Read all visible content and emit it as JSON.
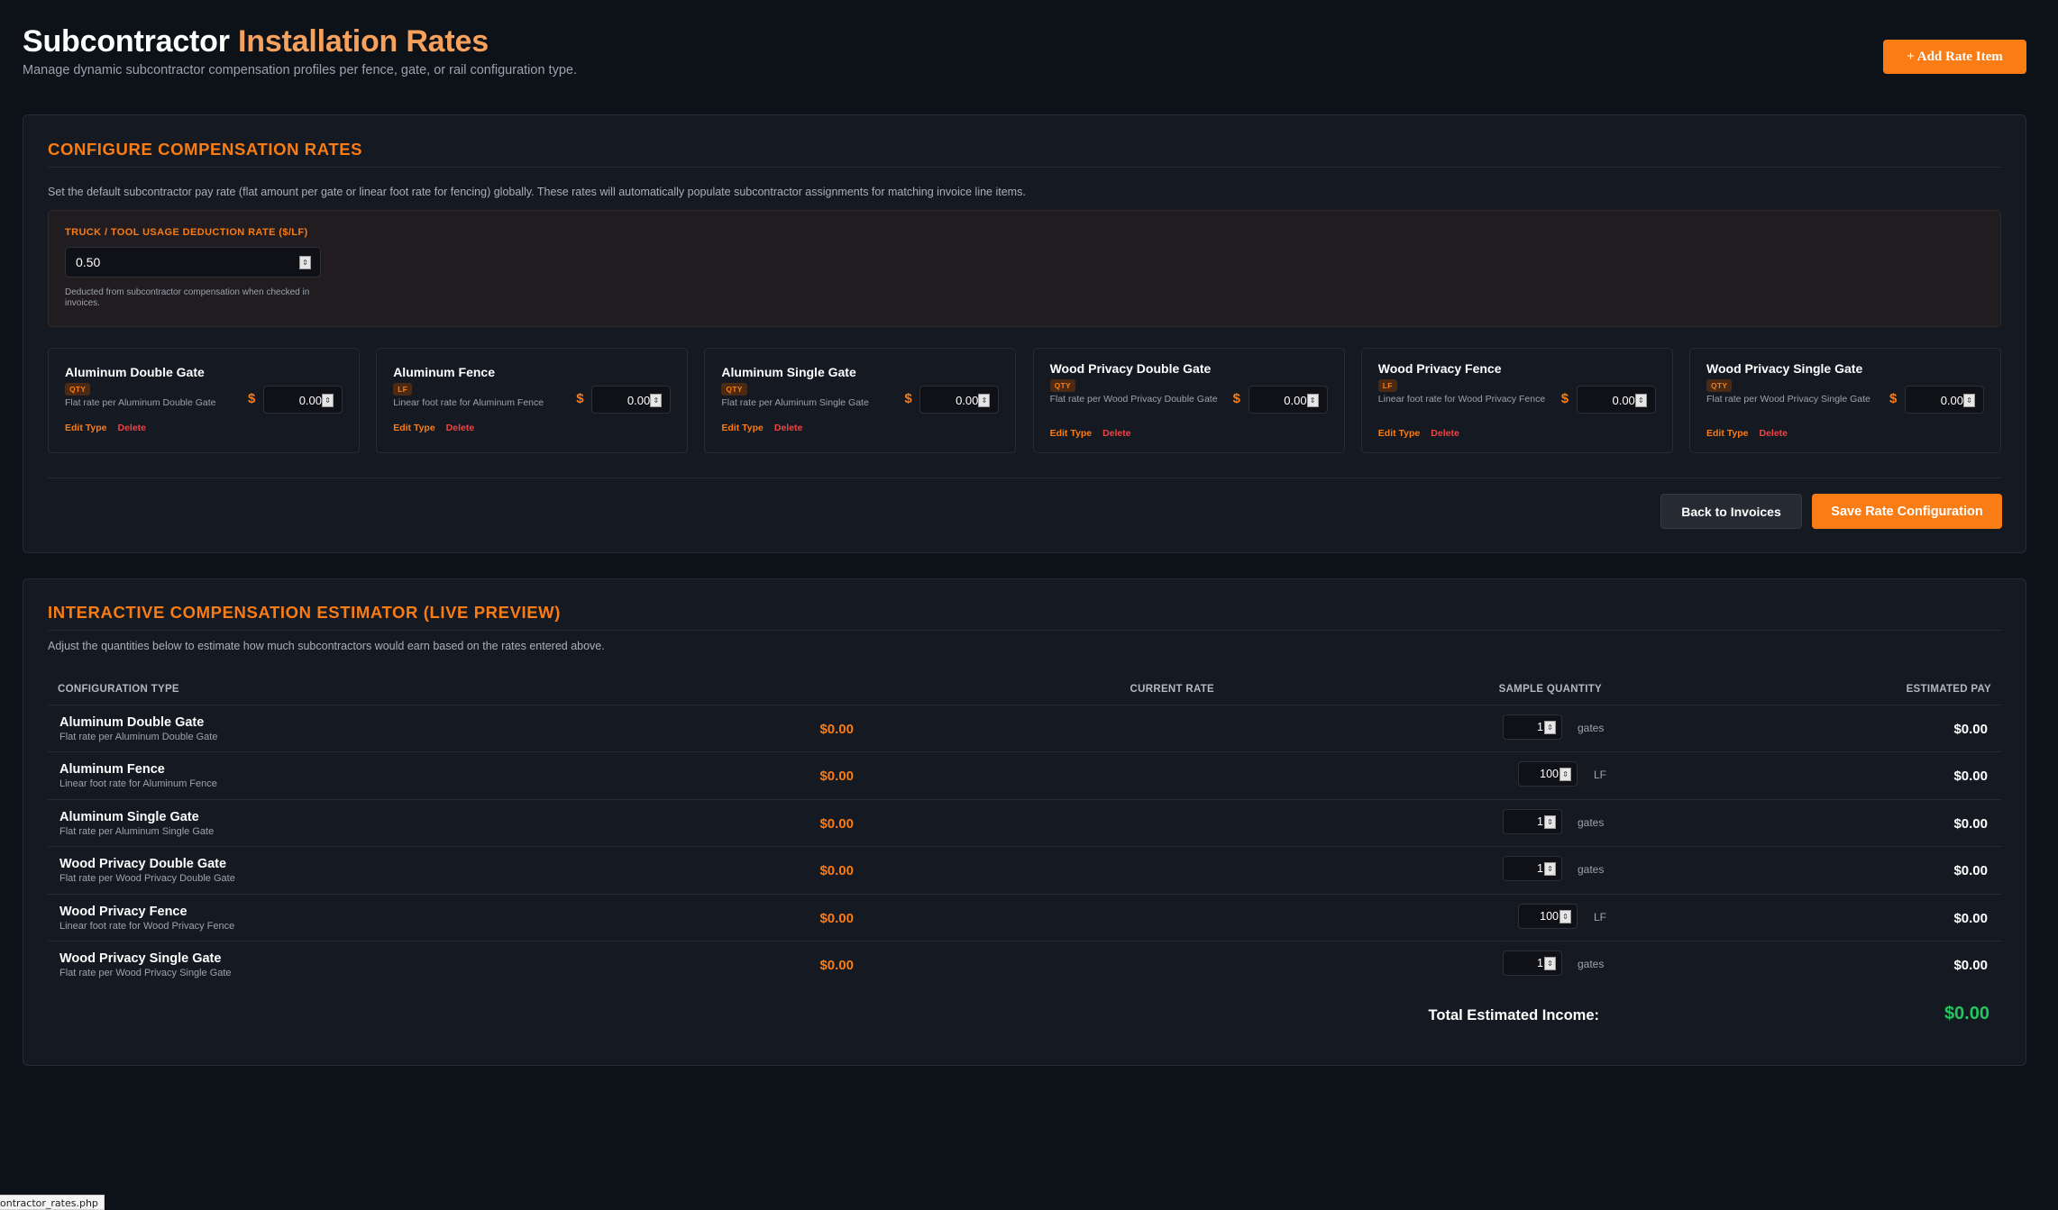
{
  "header": {
    "title_main": "Subcontractor",
    "title_accent": "Installation Rates",
    "subtitle": "Manage dynamic subcontractor compensation profiles per fence, gate, or rail configuration type.",
    "add_button": "+ Add Rate Item"
  },
  "configure": {
    "title": "CONFIGURE COMPENSATION RATES",
    "description": "Set the default subcontractor pay rate (flat amount per gate or linear foot rate for fencing) globally. These rates will automatically populate subcontractor assignments for matching invoice line items.",
    "truck": {
      "label": "TRUCK / TOOL USAGE DEDUCTION RATE ($/LF)",
      "value": "0.50",
      "note": "Deducted from subcontractor compensation when checked in invoices."
    },
    "currency_symbol": "$",
    "edit_label": "Edit Type",
    "delete_label": "Delete",
    "items": [
      {
        "name": "Aluminum Double Gate",
        "badge": "QTY",
        "desc": "Flat rate per Aluminum Double Gate",
        "value": "0.00"
      },
      {
        "name": "Aluminum Fence",
        "badge": "LF",
        "desc": "Linear foot rate for Aluminum Fence",
        "value": "0.00"
      },
      {
        "name": "Aluminum Single Gate",
        "badge": "QTY",
        "desc": "Flat rate per Aluminum Single Gate",
        "value": "0.00"
      },
      {
        "name": "Wood Privacy Double Gate",
        "badge": "QTY",
        "desc": "Flat rate per Wood Privacy Double Gate",
        "value": "0.00"
      },
      {
        "name": "Wood Privacy Fence",
        "badge": "LF",
        "desc": "Linear foot rate for Wood Privacy Fence",
        "value": "0.00"
      },
      {
        "name": "Wood Privacy Single Gate",
        "badge": "QTY",
        "desc": "Flat rate per Wood Privacy Single Gate",
        "value": "0.00"
      }
    ],
    "back_button": "Back to Invoices",
    "save_button": "Save Rate Configuration"
  },
  "estimator": {
    "title": "INTERACTIVE COMPENSATION ESTIMATOR (LIVE PREVIEW)",
    "description": "Adjust the quantities below to estimate how much subcontractors would earn based on the rates entered above.",
    "columns": [
      "CONFIGURATION TYPE",
      "CURRENT RATE",
      "SAMPLE QUANTITY",
      "ESTIMATED PAY"
    ],
    "rows": [
      {
        "name": "Aluminum Double Gate",
        "desc": "Flat rate per Aluminum Double Gate",
        "rate": "$0.00",
        "qty": "1",
        "unit": "gates",
        "pay": "$0.00"
      },
      {
        "name": "Aluminum Fence",
        "desc": "Linear foot rate for Aluminum Fence",
        "rate": "$0.00",
        "qty": "100",
        "unit": "LF",
        "pay": "$0.00"
      },
      {
        "name": "Aluminum Single Gate",
        "desc": "Flat rate per Aluminum Single Gate",
        "rate": "$0.00",
        "qty": "1",
        "unit": "gates",
        "pay": "$0.00"
      },
      {
        "name": "Wood Privacy Double Gate",
        "desc": "Flat rate per Wood Privacy Double Gate",
        "rate": "$0.00",
        "qty": "1",
        "unit": "gates",
        "pay": "$0.00"
      },
      {
        "name": "Wood Privacy Fence",
        "desc": "Linear foot rate for Wood Privacy Fence",
        "rate": "$0.00",
        "qty": "100",
        "unit": "LF",
        "pay": "$0.00"
      },
      {
        "name": "Wood Privacy Single Gate",
        "desc": "Flat rate per Wood Privacy Single Gate",
        "rate": "$0.00",
        "qty": "1",
        "unit": "gates",
        "pay": "$0.00"
      }
    ],
    "total_label": "Total Estimated Income:",
    "total_value": "$0.00"
  },
  "statusbar": {
    "url": "ontractor_rates.php"
  },
  "colors": {
    "accent": "#f97c14",
    "danger": "#ef4444",
    "success": "#22c55e",
    "background": "#0d1118"
  }
}
